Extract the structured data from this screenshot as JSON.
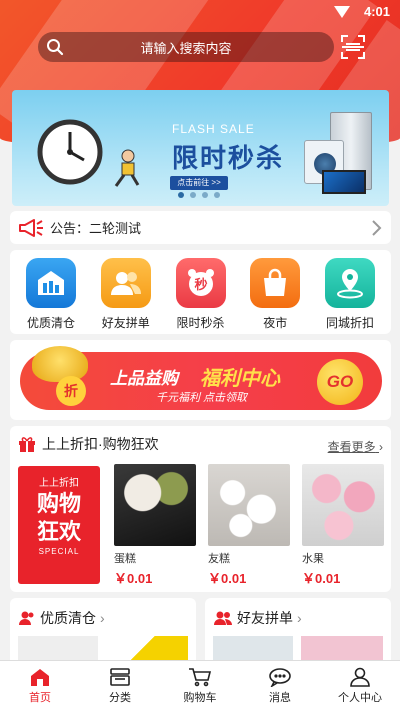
{
  "status": {
    "time": "4:01"
  },
  "search": {
    "placeholder": "请输入搜索内容"
  },
  "banner": {
    "en": "FLASH SALE",
    "cn": "限时秒杀",
    "button": "点击前往 >>"
  },
  "notice": {
    "label": "公告：",
    "text": "二轮测试"
  },
  "quick": [
    {
      "label": "优质清仓",
      "icon": "warehouse-icon",
      "color": "#1e8fe6"
    },
    {
      "label": "好友拼单",
      "icon": "friends-icon",
      "color": "#f6a21d"
    },
    {
      "label": "限时秒杀",
      "icon": "alarm-clock-icon",
      "color": "#f0454a"
    },
    {
      "label": "夜市",
      "icon": "shopping-bag-icon",
      "color": "#f77a1a"
    },
    {
      "label": "同城折扣",
      "icon": "location-icon",
      "color": "#1fc6b0"
    }
  ],
  "welfare": {
    "part1": "上品益购",
    "part2": "福利中心",
    "sub": "千元福利   点击领取",
    "go": "GO",
    "badge": "折"
  },
  "section": {
    "title": "上上折扣·购物狂欢",
    "more": "查看更多",
    "promo": {
      "line1": "上上折扣",
      "line2a": "购物",
      "line2b": "狂欢",
      "line3": "SPECIAL"
    },
    "products": [
      {
        "name": "蛋糕",
        "price": "￥0.01"
      },
      {
        "name": "友糕",
        "price": "￥0.01"
      },
      {
        "name": "水果",
        "price": "￥0.01"
      }
    ]
  },
  "clearance": {
    "title": "优质清仓"
  },
  "group": {
    "title": "好友拼单"
  },
  "tabs": [
    {
      "label": "首页",
      "icon": "home-icon"
    },
    {
      "label": "分类",
      "icon": "category-icon"
    },
    {
      "label": "购物车",
      "icon": "cart-icon"
    },
    {
      "label": "消息",
      "icon": "message-icon"
    },
    {
      "label": "个人中心",
      "icon": "user-icon"
    }
  ]
}
